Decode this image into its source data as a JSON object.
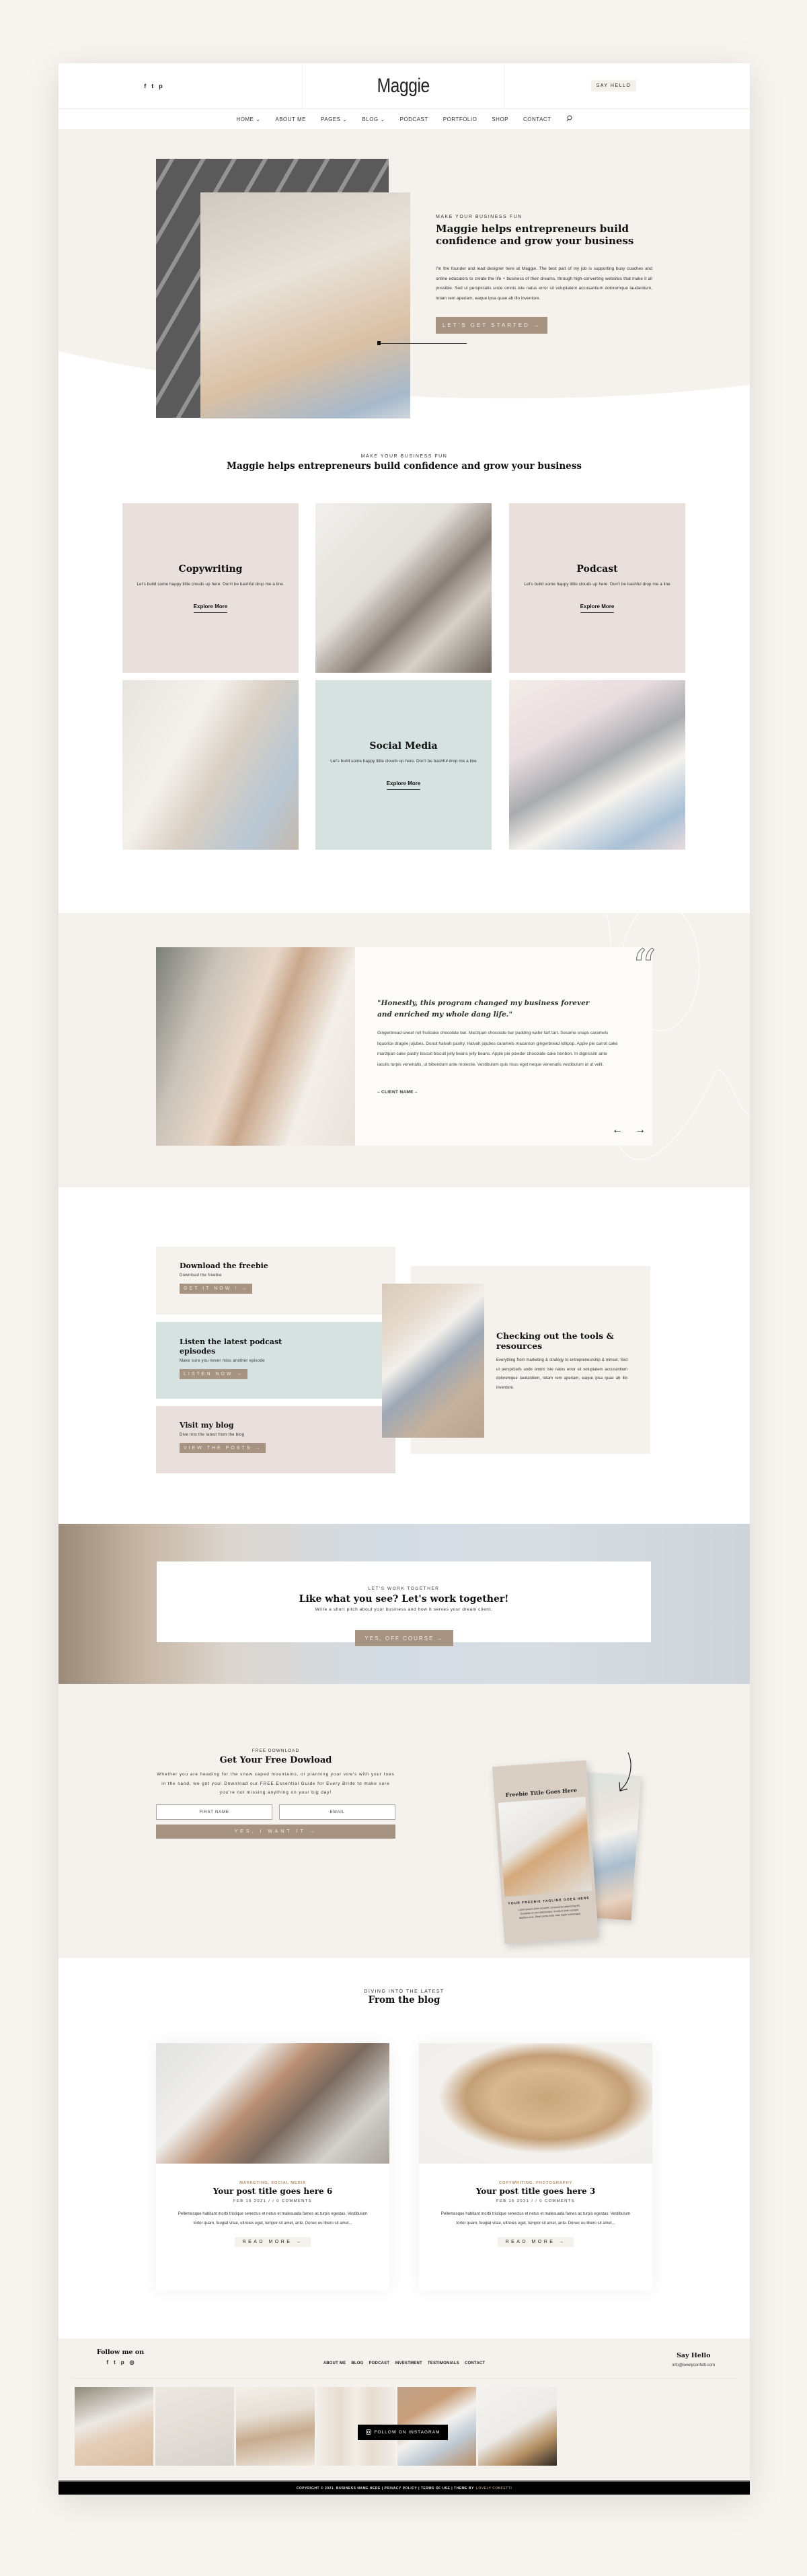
{
  "header": {
    "social": [
      "f",
      "t",
      "p"
    ],
    "logo": "Maggie",
    "say_hello": "SAY HELLO",
    "nav": [
      "HOME ⌄",
      "ABOUT ME",
      "PAGES ⌄",
      "BLOG ⌄",
      "PODCAST",
      "PORTFOLIO",
      "SHOP",
      "CONTACT"
    ],
    "search_icon": "search-icon"
  },
  "hero": {
    "eyebrow": "MAKE YOUR BUSINESS FUN",
    "title": "Maggie helps entrepreneurs build confidence and grow your business",
    "body": "I'm the founder and lead designer here at Maggie. The best part of my job is supporting busy coaches and online educators to create the life + business of their dreams, through high-converting websites that make it all possible. Sed ut perspiciatis unde omnis iste natus error sit voluptatem accusantium doloremque laudantium, totam rem aperiam, eaque ipsa quae ab illo inventore.",
    "button": "LET'S GET STARTED →"
  },
  "services": {
    "eyebrow": "MAKE YOUR BUSINESS FUN",
    "title": "Maggie helps entrepreneurs build confidence and grow your business",
    "tiles": [
      {
        "title": "Copywriting",
        "text": "Let's build some happy little clouds up here. Don't be bashful drop me a line.",
        "link": "Explore More"
      },
      {
        "title": "Podcast",
        "text": "Let's build some happy little clouds up here. Don't be bashful drop me a line",
        "link": "Explore More"
      },
      {
        "title": "Social Media",
        "text": "Let's build some happy little clouds up here. Don't be bashful drop me a line",
        "link": "Explore More"
      }
    ],
    "colors": {
      "pink": "#e9e0de",
      "sage": "#d6e2df"
    }
  },
  "testimonial": {
    "quote": "\"Honestly, this program changed my business forever and enriched my whole dang life.\"",
    "body": "Gingerbread sweet roll fruitcake chocolate bar. Marzipan chocolate bar pudding wafer tart tart. Sesame snaps caramels liquorice dragée jujubes. Donut halvah pastry. Halvah jujubes caramels macaroon gingerbread lollipop. Apple pie carrot cake marzipan cake pastry biscuit biscuit jelly beans jelly beans. Apple pie powder chocolate cake bonbon. In dignissim ante iaculis turpis venenatis, ut bibendum ante molestie. Vestibulum quis risus eget neque venenatis vestibulum ut ut velit.",
    "client": "– CLIENT NAME –",
    "prev": "←",
    "next": "→"
  },
  "resources": {
    "boxes": [
      {
        "title": "Download the freebie",
        "text": "Download the freebie",
        "button": "GET IT NOW ! →"
      },
      {
        "title": "Listen the latest podcast episodes",
        "text": "Make sure you never miss another episode",
        "button": "LISTEN NOW →"
      },
      {
        "title": "Visit my blog",
        "text": "Dive into the latest from the blog",
        "button": "VIEW THE POSTS →"
      }
    ],
    "card_title": "Checking out the tools & resources",
    "card_text": "Everything from marketing & strategy to entrepreneurship & minset. Sed ut perspiciatis unde omnis iste natus error sit voluptatem accusantium doloremque laudantium, totam rem aperiam, eaque ipsa quae ab illo inventore."
  },
  "cta": {
    "eyebrow": "LET'S WORK TOGETHER",
    "title": "Like what you see? Let's work together!",
    "subtitle": "Write a short pitch about your business and how it serves your dream client.",
    "button": "YES, OFF COURSE →"
  },
  "freebie": {
    "eyebrow": "FREE DOWNLOAD",
    "title": "Get Your Free Dowload",
    "body": "Whether you are heading for the snow caped mountains, or planning your vow's with your toes in the sand, we got you! Download our FREE Essential Guide for Every Bride to make sure you're not missing anything on your big day!",
    "first_name_placeholder": "FIRST NAME",
    "email_placeholder": "EMAIL",
    "submit": "YES, I WANT IT →",
    "mockup_title": "Freebie Title Goes Here",
    "mockup_tagline": "YOUR FREEBIE TAGLINE GOES HERE",
    "mockup_text": "Lorem ipsum dolor sit amet, consectetur adipiscing elit. Curabitur et orci ullamcorper, tincidunt ante suscipit, dapibus eros. Etiam porta nulla vitae ligula scelerisque"
  },
  "blog": {
    "eyebrow": "DIVING INTO THE LATEST",
    "title": "From the blog",
    "posts": [
      {
        "categories": "MARKETING, SOCIAL MEDIA",
        "title": "Your post title goes here 6",
        "meta": "FEB 15 2021 / / 0 COMMENTS",
        "excerpt": "Pellentesque habitant morbi tristique senectus et netus et malesuada fames ac turpis egestas. Vestibulum tortor quam, feugiat vitae, ultricies eget, tempor sit amet, ante. Donec eu libero sit amet...",
        "more": "READ MORE →"
      },
      {
        "categories": "COPYWRITING, PHOTOGRAPHY",
        "title": "Your post title goes here 3",
        "meta": "FEB 15 2021 / / 0 COMMENTS",
        "excerpt": "Pellentesque habitant morbi tristique senectus et netus et malesuada fames ac turpis egestas. Vestibulum tortor quam, feugiat vitae, ultricies eget, tempor sit amet, ante. Donec eu libero sit amet...",
        "more": "READ MORE →"
      }
    ]
  },
  "footer": {
    "follow_title": "Follow me on",
    "social": [
      "f",
      "t",
      "p",
      "◎"
    ],
    "nav": [
      "ABOUT ME",
      "BLOG",
      "PODCAST",
      "INVESTMENT",
      "TESTIMONIALS",
      "CONTACT"
    ],
    "hello_title": "Say Hello",
    "email": "info@lovelyconfetti.com",
    "instagram_button": "FOLLOW ON INSTAGRAM",
    "copyright": "COPYRIGHT © 2021. BUSINESS NAME HERE | PRIVACY POLICY | TERMS OF USE | THEME BY",
    "theme_brand": "LOVELY CONFETTI"
  },
  "colors": {
    "accent": "#a69381",
    "cream": "#f5f2ee",
    "blush": "#e9e0de",
    "sage": "#d6e2df",
    "category": "#b6906b"
  }
}
